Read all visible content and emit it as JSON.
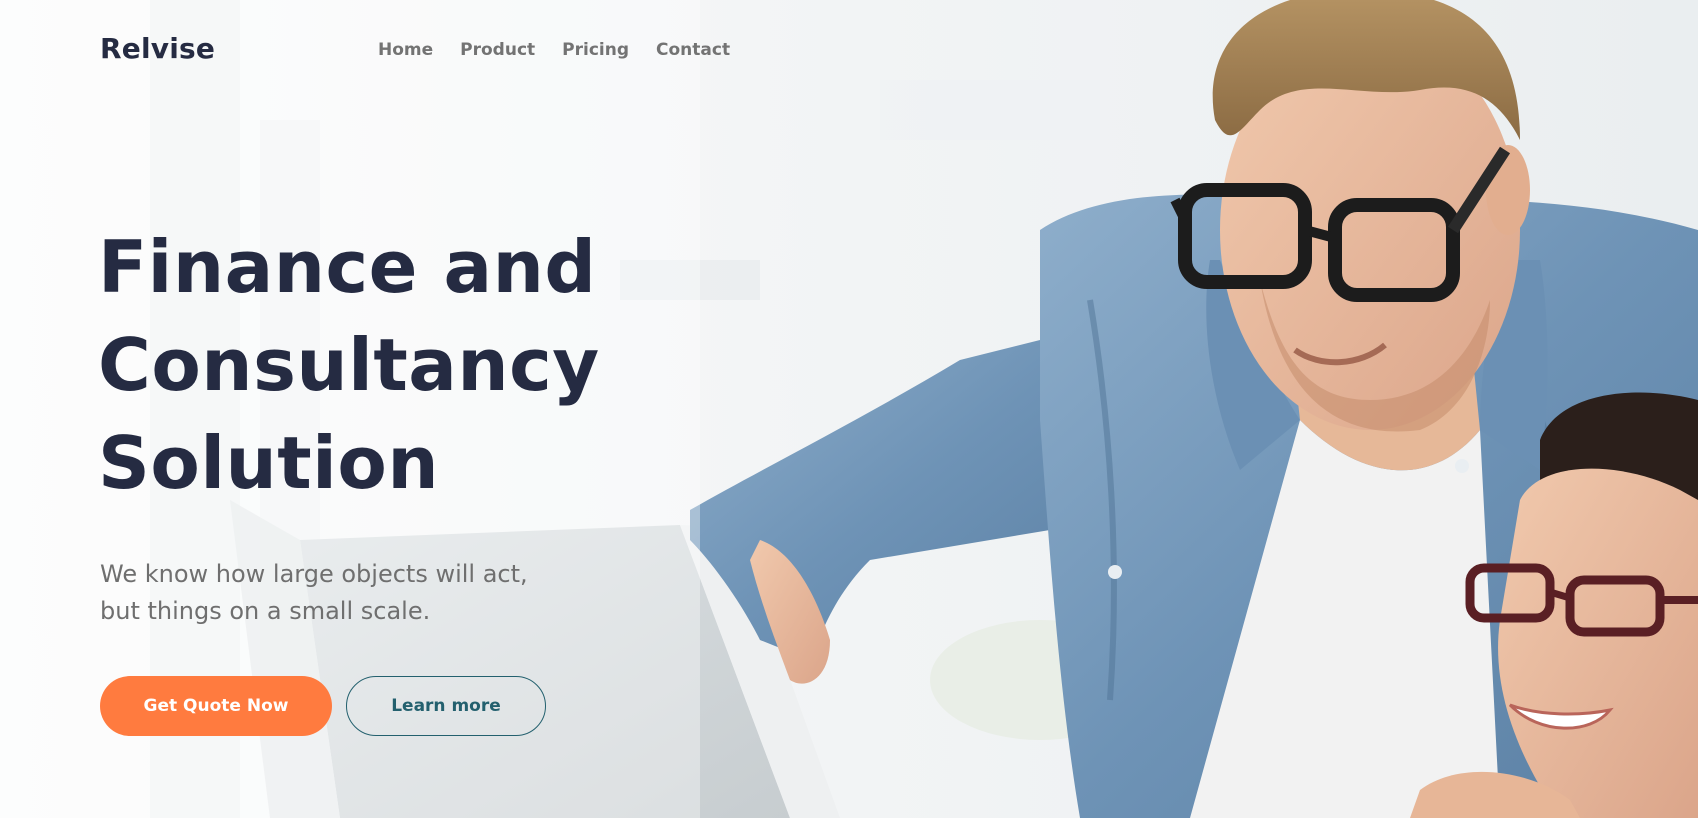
{
  "brand": {
    "name": "Relvise"
  },
  "nav": {
    "items": [
      {
        "label": "Home"
      },
      {
        "label": "Product"
      },
      {
        "label": "Pricing"
      },
      {
        "label": "Contact"
      }
    ]
  },
  "hero": {
    "headline_lines": [
      "Finance and",
      "Consultancy",
      "Solution"
    ],
    "subtext_lines": [
      "We know how large objects will act,",
      "but things on a small scale."
    ],
    "primary_button": "Get Quote Now",
    "secondary_button": "Learn more"
  },
  "colors": {
    "heading": "#252b42",
    "nav_text": "#737373",
    "primary": "#ff7b3f",
    "secondary": "#23606e",
    "body_text": "#6f6f6f"
  }
}
